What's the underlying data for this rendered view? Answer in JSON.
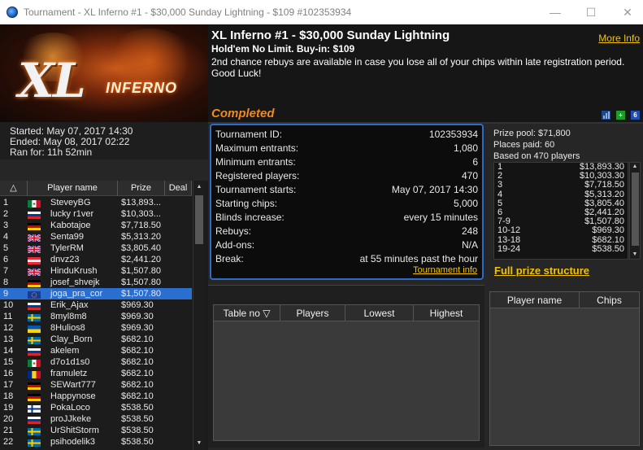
{
  "window": {
    "title": "Tournament - XL Inferno #1 - $30,000 Sunday Lightning - $109 #102353934",
    "controls": {
      "minimize": "—",
      "maximize": "☐",
      "close": "✕"
    }
  },
  "banner": {
    "logo_main": "XL",
    "logo_sub": "INFERNO"
  },
  "times": {
    "started": "Started: May 07, 2017 14:30",
    "ended": "Ended: May 08, 2017 02:22",
    "ran_for": "Ran for: 11h 52min"
  },
  "header": {
    "name": "XL Inferno #1 - $30,000 Sunday Lightning",
    "game": "Hold'em No Limit. Buy-in: $109",
    "description": "2nd chance rebuys are available in case you lose all of your chips within late registration period. Good Luck!",
    "more_info": "More Info",
    "status": "Completed",
    "status_color": "#f08a1c",
    "icons": [
      "bar-chart-icon",
      "plus-icon",
      "six-icon"
    ]
  },
  "details": {
    "rows": [
      {
        "label": "Tournament ID:",
        "value": "102353934"
      },
      {
        "label": "Maximum entrants:",
        "value": "1,080"
      },
      {
        "label": "Minimum entrants:",
        "value": "6"
      },
      {
        "label": "Registered players:",
        "value": "470"
      },
      {
        "label": "Tournament starts:",
        "value": "May 07, 2017 14:30"
      },
      {
        "label": "Starting chips:",
        "value": "5,000"
      },
      {
        "label": "Blinds increase:",
        "value": "every 15 minutes"
      },
      {
        "label": "Rebuys:",
        "value": "248"
      },
      {
        "label": "Add-ons:",
        "value": "N/A"
      },
      {
        "label": "Break:",
        "value": "at 55 minutes past the hour"
      }
    ],
    "tournament_info": "Tournament info",
    "accent": "#2c6bc9"
  },
  "prize": {
    "pool": "Prize pool: $71,800",
    "places": "Places paid: 60",
    "based": "Based on 470 players",
    "rows": [
      {
        "place": "1",
        "amount": "$13,893.30"
      },
      {
        "place": "2",
        "amount": "$10,303.30"
      },
      {
        "place": "3",
        "amount": "$7,718.50"
      },
      {
        "place": "4",
        "amount": "$5,313.20"
      },
      {
        "place": "5",
        "amount": "$3,805.40"
      },
      {
        "place": "6",
        "amount": "$2,441.20"
      },
      {
        "place": "7-9",
        "amount": "$1,507.80"
      },
      {
        "place": "10-12",
        "amount": "$969.30"
      },
      {
        "place": "13-18",
        "amount": "$682.10"
      },
      {
        "place": "19-24",
        "amount": "$538.50"
      }
    ],
    "full_structure": "Full prize structure"
  },
  "players": {
    "columns": [
      "△",
      "Player name",
      "Prize",
      "Deal"
    ],
    "rows": [
      {
        "n": "1",
        "flag": "mx",
        "name": "SteveyBG",
        "prize": "$13,893..."
      },
      {
        "n": "2",
        "flag": "ru",
        "name": "lucky r1ver",
        "prize": "$10,303..."
      },
      {
        "n": "3",
        "flag": "de",
        "name": "Kabotajoe",
        "prize": "$7,718.50"
      },
      {
        "n": "4",
        "flag": "gb",
        "name": "Senta99",
        "prize": "$5,313.20"
      },
      {
        "n": "5",
        "flag": "gb",
        "name": "TylerRM",
        "prize": "$3,805.40"
      },
      {
        "n": "6",
        "flag": "at",
        "name": "dnvz23",
        "prize": "$2,441.20"
      },
      {
        "n": "7",
        "flag": "gb",
        "name": "HinduKrush",
        "prize": "$1,507.80"
      },
      {
        "n": "8",
        "flag": "de",
        "name": "josef_shvejk",
        "prize": "$1,507.80"
      },
      {
        "n": "9",
        "flag": "eu",
        "name": "joga_pra_cor",
        "prize": "$1,507.80",
        "selected": true
      },
      {
        "n": "10",
        "flag": "ru",
        "name": "Erik_Ajax",
        "prize": "$969.30"
      },
      {
        "n": "11",
        "flag": "se",
        "name": "8myl8m8",
        "prize": "$969.30"
      },
      {
        "n": "12",
        "flag": "ua",
        "name": "8Hulios8",
        "prize": "$969.30"
      },
      {
        "n": "13",
        "flag": "se",
        "name": "Clay_Born",
        "prize": "$682.10"
      },
      {
        "n": "14",
        "flag": "ru",
        "name": "akelem",
        "prize": "$682.10"
      },
      {
        "n": "15",
        "flag": "mx",
        "name": "d7o1d1s0",
        "prize": "$682.10"
      },
      {
        "n": "16",
        "flag": "ro",
        "name": "framuletz",
        "prize": "$682.10"
      },
      {
        "n": "17",
        "flag": "de",
        "name": "SEWart777",
        "prize": "$682.10"
      },
      {
        "n": "18",
        "flag": "de",
        "name": "Happynose",
        "prize": "$682.10"
      },
      {
        "n": "19",
        "flag": "fi",
        "name": "PokaLoco",
        "prize": "$538.50"
      },
      {
        "n": "20",
        "flag": "ru",
        "name": "proJJkeke",
        "prize": "$538.50"
      },
      {
        "n": "21",
        "flag": "se",
        "name": "UrShitStorm",
        "prize": "$538.50"
      },
      {
        "n": "22",
        "flag": "se",
        "name": "psihodelik3",
        "prize": "$538.50"
      }
    ]
  },
  "tables": {
    "columns": [
      "Table no ▽",
      "Players",
      "Lowest",
      "Highest"
    ]
  },
  "chips": {
    "columns": [
      "Player name",
      "Chips"
    ]
  }
}
